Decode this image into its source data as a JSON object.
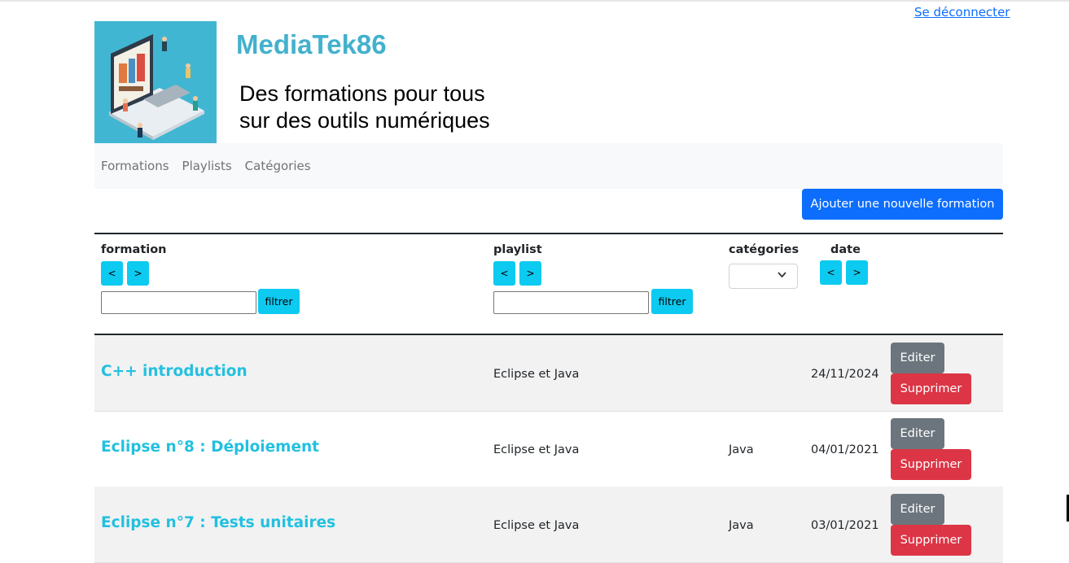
{
  "header": {
    "logout_label": "Se déconnecter",
    "brand": "MediaTek86",
    "tagline_line1": "Des formations pour tous",
    "tagline_line2": "sur des outils numériques",
    "logo_icon": "laptop-illustration-icon"
  },
  "nav": {
    "items": [
      {
        "label": "Formations"
      },
      {
        "label": "Playlists"
      },
      {
        "label": "Catégories"
      }
    ]
  },
  "actions": {
    "add_label": "Ajouter une nouvelle formation"
  },
  "table_header": {
    "formation": "formation",
    "playlist": "playlist",
    "categories": "catégories",
    "date": "date",
    "sort_prev": "<",
    "sort_next": ">",
    "filter_label": "filtrer",
    "category_selected": ""
  },
  "rows": [
    {
      "title": "C++ introduction",
      "playlist": "Eclipse et Java",
      "category": "",
      "date": "24/11/2024",
      "edit": "Editer",
      "delete": "Supprimer"
    },
    {
      "title": "Eclipse n°8 : Déploiement",
      "playlist": "Eclipse et Java",
      "category": "Java",
      "date": "04/01/2021",
      "edit": "Editer",
      "delete": "Supprimer"
    },
    {
      "title": "Eclipse n°7 : Tests unitaires",
      "playlist": "Eclipse et Java",
      "category": "Java",
      "date": "03/01/2021",
      "edit": "Editer",
      "delete": "Supprimer"
    }
  ],
  "colors": {
    "primary": "#0d6efd",
    "info": "#0dcaf0",
    "secondary": "#6c757d",
    "danger": "#dc3545",
    "brand": "#43b1cd",
    "title_link": "#23c0e0"
  }
}
